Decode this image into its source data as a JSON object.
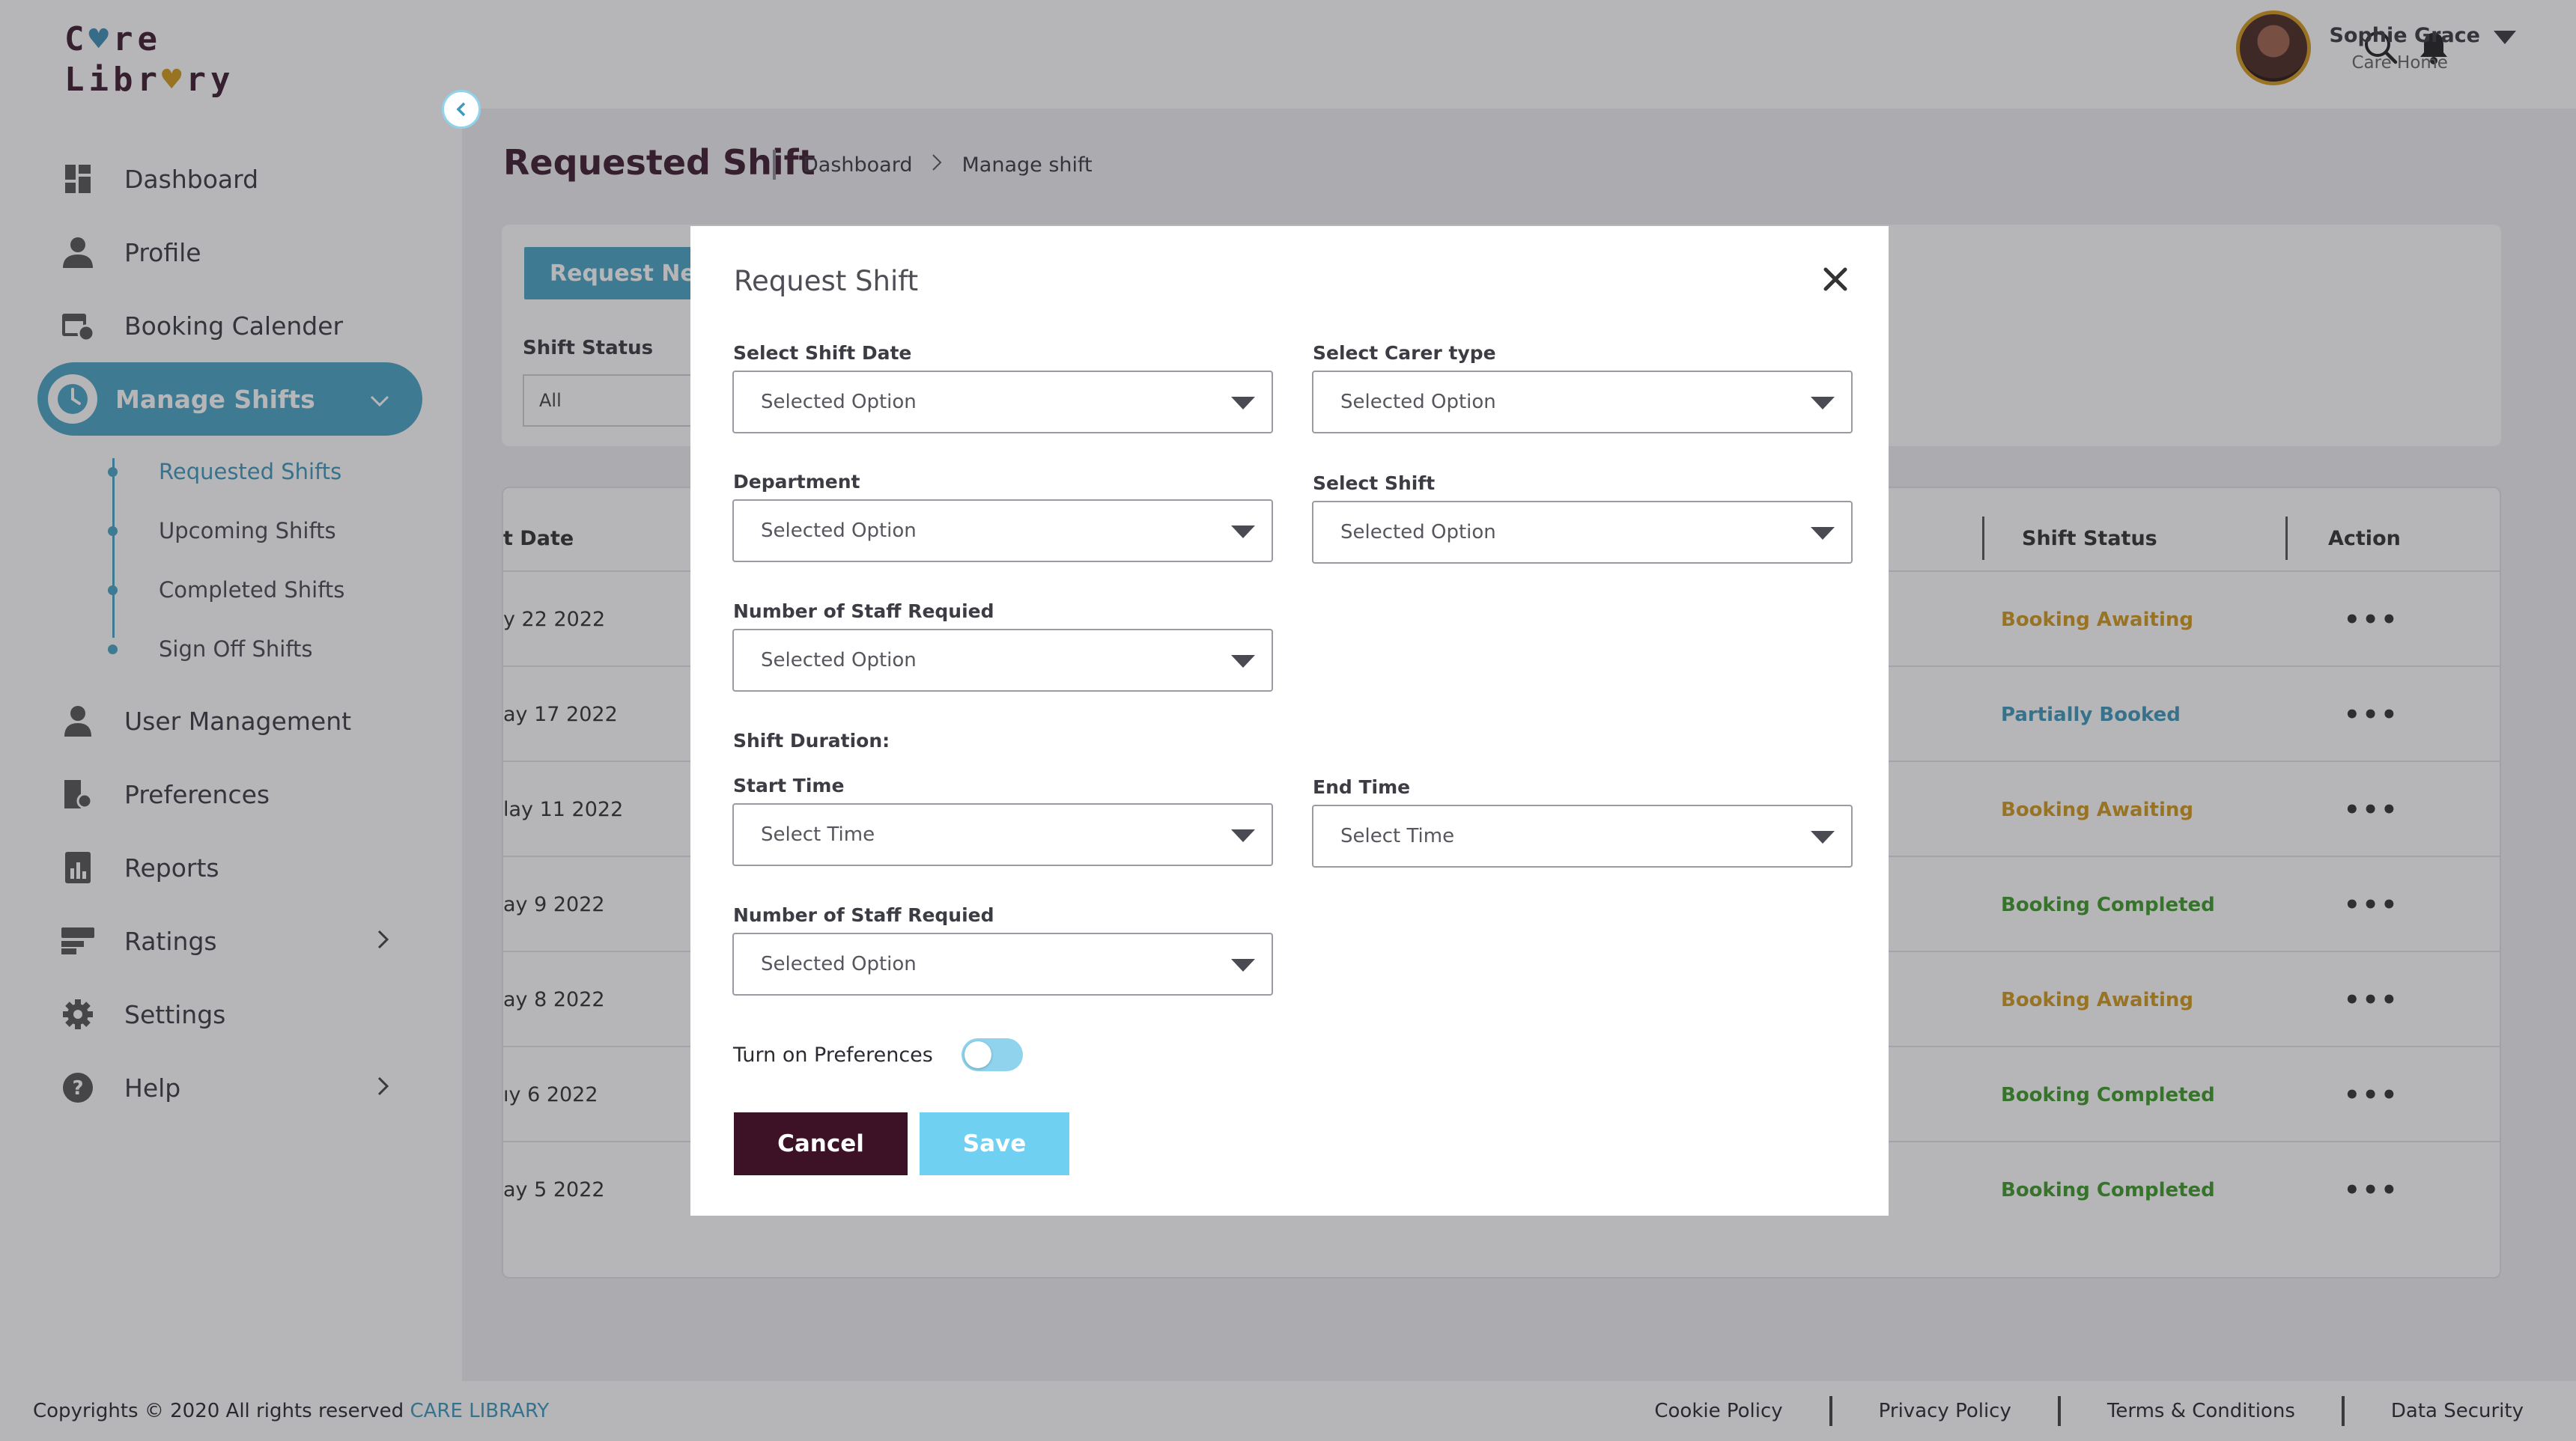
{
  "app": {
    "logo_line1_a": "C",
    "logo_line1_b": "re",
    "logo_line2_a": "Libr",
    "logo_line2_b": "ry"
  },
  "sidebar": {
    "items": [
      {
        "label": "Dashboard",
        "icon": "dashboard-icon"
      },
      {
        "label": "Profile",
        "icon": "profile-icon"
      },
      {
        "label": "Booking Calender",
        "icon": "calendar-icon"
      },
      {
        "label": "Manage Shifts",
        "icon": "clock-icon"
      },
      {
        "label": "User Management",
        "icon": "user-management-icon"
      },
      {
        "label": "Preferences",
        "icon": "preferences-icon"
      },
      {
        "label": "Reports",
        "icon": "reports-icon"
      },
      {
        "label": "Ratings",
        "icon": "ratings-icon"
      },
      {
        "label": "Settings",
        "icon": "gear-icon"
      },
      {
        "label": "Help",
        "icon": "help-icon"
      }
    ],
    "sub_items": [
      {
        "label": "Requested Shifts"
      },
      {
        "label": "Upcoming Shifts"
      },
      {
        "label": "Completed Shifts"
      },
      {
        "label": "Sign Off Shifts"
      }
    ]
  },
  "user": {
    "name": "Sophie Grace",
    "role": "Care Home"
  },
  "page": {
    "title": "Requested Shift",
    "breadcrumb": [
      "Dashboard",
      "Manage shift"
    ]
  },
  "filters": {
    "request_new_label": "Request New",
    "shift_status_label": "Shift Status",
    "shift_status_value": "All"
  },
  "table": {
    "headers": {
      "date": "t Date",
      "status": "Shift Status",
      "action": "Action"
    },
    "rows": [
      {
        "date": "y 22 2022",
        "status": "Booking Awaiting",
        "action": "•••"
      },
      {
        "date": "ay 17 2022",
        "status": "Partially Booked",
        "action": "•••"
      },
      {
        "date": "lay 11 2022",
        "status": "Booking Awaiting",
        "action": "•••"
      },
      {
        "date": "ay 9 2022",
        "status": "Booking Completed",
        "action": "•••"
      },
      {
        "date": "ay 8 2022",
        "status": "Booking Awaiting",
        "action": "•••"
      },
      {
        "date": "ıy 6 2022",
        "status": "Booking Completed",
        "action": "•••"
      },
      {
        "date": "ay 5 2022",
        "status": "Booking Completed",
        "action": "•••"
      }
    ]
  },
  "status_colors": {
    "Booking Awaiting": "#d49a1f",
    "Partially Booked": "#3f98bd",
    "Booking Completed": "#3f9b2a"
  },
  "modal": {
    "title": "Request Shift",
    "fields": {
      "shift_date": {
        "label": "Select Shift Date",
        "value": "Selected Option"
      },
      "carer_type": {
        "label": "Select Carer type",
        "value": "Selected Option"
      },
      "department": {
        "label": "Department",
        "value": "Selected Option"
      },
      "select_shift": {
        "label": "Select Shift",
        "value": "Selected Option"
      },
      "staff_required_1": {
        "label": "Number of Staff Requied",
        "value": "Selected Option"
      },
      "duration_label": "Shift Duration:",
      "start_time": {
        "label": "Start Time",
        "value": "Select Time"
      },
      "end_time": {
        "label": "End Time",
        "value": "Select Time"
      },
      "staff_required_2": {
        "label": "Number of Staff Requied",
        "value": "Selected Option"
      }
    },
    "preferences_label": "Turn on Preferences",
    "preferences_on": false,
    "cancel_label": "Cancel",
    "save_label": "Save"
  },
  "footer": {
    "copyright": "Copyrights © 2020  All rights reserved ",
    "brand": "CARE LIBRARY",
    "links": [
      "Cookie Policy",
      "Privacy Policy",
      "Terms & Conditions",
      "Data Security"
    ]
  },
  "colors": {
    "accent": "#4aa4c4",
    "brand_dark": "#3d1227",
    "save": "#6fd0f2"
  }
}
